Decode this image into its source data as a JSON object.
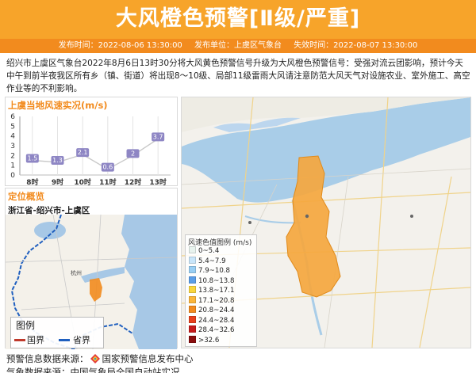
{
  "header": {
    "title": "大风橙色预警[Ⅱ级/严重]",
    "publish_time": "发布时间：2022-08-06 13:30:00",
    "publisher": "发布单位：上虞区气象台",
    "expire_time": "失效时间：2022-08-07 13:30:00",
    "bg_color": "#f7a42a"
  },
  "description": "绍兴市上虞区气象台2022年8月6日13时30分将大风黄色预警信号升级为大风橙色预警信号：受强对流云团影响，预计今天中午到前半夜我区所有乡（镇、街道）将出现8～10级、局部11级雷雨大风请注意防范大风天气对设施农业、室外施工、高空作业等的不利影响。",
  "wind_panel": {
    "title": "上虞当地风速实况(m/s)"
  },
  "chart_data": {
    "type": "line",
    "title": "上虞当地风速实况(m/s)",
    "categories": [
      "8时",
      "9时",
      "10时",
      "11时",
      "12时",
      "13时"
    ],
    "values": [
      1.5,
      1.3,
      2.1,
      0.6,
      2,
      3.7
    ],
    "value_labels": [
      "1.5",
      "1.3",
      "2.1",
      "0.6",
      "2",
      "3.7"
    ],
    "y_ticks": [
      "0",
      "1",
      "2",
      "3",
      "4",
      "5",
      "6"
    ],
    "ylim": [
      0,
      6
    ],
    "xlabel": "",
    "ylabel": "",
    "grid": "vertical",
    "line_color": "#c9c9c9",
    "marker_color": "#8e86c4"
  },
  "locate_panel": {
    "title": "定位概览",
    "location": "浙江省-绍兴市-上虞区",
    "legend_title": "图例",
    "legend_items": [
      {
        "label": "国界",
        "color": "#c0392b"
      },
      {
        "label": "省界",
        "color": "#1f5fbf"
      }
    ],
    "place_label": "杭州"
  },
  "wind_legend": {
    "title": "风速色值图例 (m/s)",
    "items": [
      {
        "label": "0~5.4",
        "color": "#e8f3ee"
      },
      {
        "label": "5.4~7.9",
        "color": "#c9e6fa"
      },
      {
        "label": "7.9~10.8",
        "color": "#99cff4"
      },
      {
        "label": "10.8~13.8",
        "color": "#5b9ee8"
      },
      {
        "label": "13.8~17.1",
        "color": "#f9d63e"
      },
      {
        "label": "17.1~20.8",
        "color": "#fbb63a"
      },
      {
        "label": "20.8~24.4",
        "color": "#f28b1e"
      },
      {
        "label": "24.4~28.4",
        "color": "#e8401c"
      },
      {
        "label": "28.4~32.6",
        "color": "#c61b1b"
      },
      {
        "label": ">32.6",
        "color": "#8a0e0e"
      }
    ]
  },
  "footer": {
    "source_label": "预警信息数据来源：",
    "source_name": "国家预警信息发布中心",
    "data_source": "气象数据来源：中国气象局全国自动站实况"
  }
}
